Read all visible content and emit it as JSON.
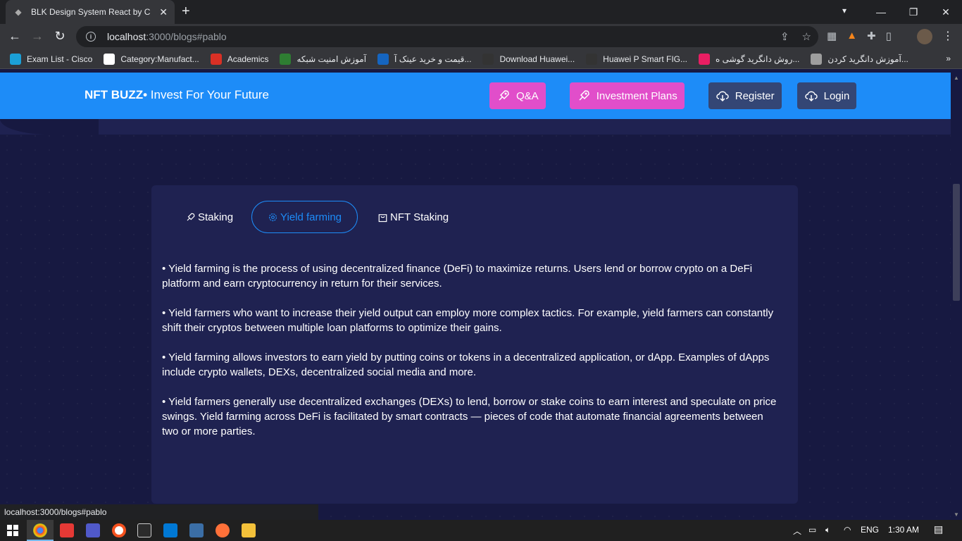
{
  "browser": {
    "tab_title": "BLK Design System React by Creative Tim",
    "url_host": "localhost",
    "url_rest": ":3000/blogs#pablo",
    "bookmarks": [
      {
        "label": "Exam List - Cisco",
        "color": "#1ba0d7"
      },
      {
        "label": "Category:Manufact...",
        "color": "#ffffff"
      },
      {
        "label": "Academics",
        "color": "#d93025"
      },
      {
        "label": "آموزش امنیت شبکه",
        "color": "#2e7d32"
      },
      {
        "label": "قیمت و خرید عینک آ...",
        "color": "#1565c0"
      },
      {
        "label": "Download Huawei...",
        "color": "#333333"
      },
      {
        "label": "Huawei P Smart FIG...",
        "color": "#333333"
      },
      {
        "label": "روش دانگرید گوشی ه...",
        "color": "#e91e63"
      },
      {
        "label": "آموزش دانگرید کردن...",
        "color": "#9e9e9e"
      }
    ],
    "status_url": "localhost:3000/blogs#pablo"
  },
  "navbar": {
    "brand_bold": "NFT BUZZ•",
    "brand_tagline": " Invest For Your Future",
    "buttons": {
      "qa": "Q&A",
      "plans": "Investment Plans",
      "register": "Register",
      "login": "Login"
    }
  },
  "tabs": {
    "staking": "Staking",
    "yield": "Yield farming",
    "nft": "NFT Staking"
  },
  "content": {
    "p1": "• Yield farming is the process of using decentralized finance (DeFi) to maximize returns. Users lend or borrow crypto on a DeFi platform and earn cryptocurrency in return for their services.",
    "p2": "• Yield farmers who want to increase their yield output can employ more complex tactics. For example, yield farmers can constantly shift their cryptos between multiple loan platforms to optimize their gains.",
    "p3": "• Yield farming allows investors to earn yield by putting coins or tokens in a decentralized application, or dApp. Examples of dApps include crypto wallets, DEXs, decentralized social media and more.",
    "p4": "• Yield farmers generally use decentralized exchanges (DEXs) to lend, borrow or stake coins to earn interest and speculate on price swings. Yield farming across DeFi is facilitated by smart contracts — pieces of code that automate financial agreements between two or more parties."
  },
  "taskbar": {
    "lang": "ENG",
    "time": "1:30 AM"
  },
  "colors": {
    "primary": "#1d8cf8",
    "pink": "#e14eca",
    "dark_button": "#344675",
    "page_bg": "#171941",
    "card_bg": "#1f2251"
  }
}
